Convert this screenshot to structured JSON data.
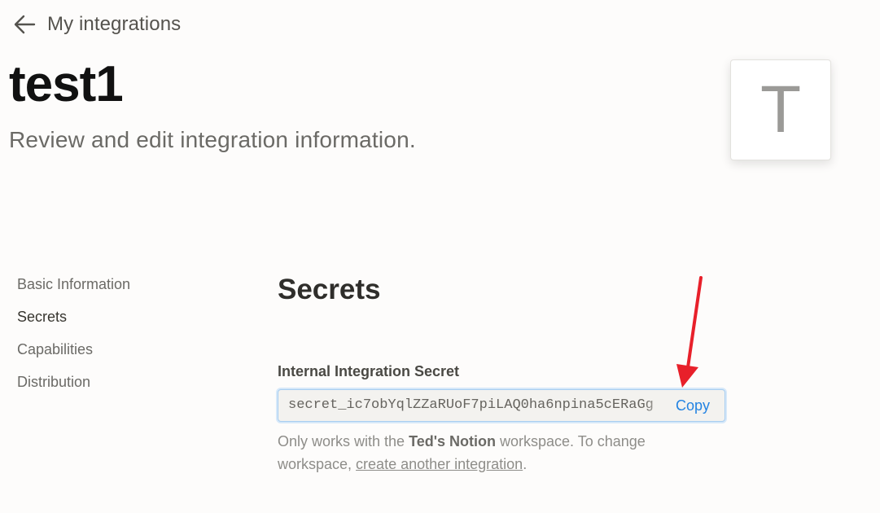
{
  "header": {
    "back_label": "My integrations",
    "title": "test1",
    "subtitle": "Review and edit integration information.",
    "avatar_letter": "T"
  },
  "sidebar": {
    "items": [
      {
        "label": "Basic Information",
        "active": false
      },
      {
        "label": "Secrets",
        "active": true
      },
      {
        "label": "Capabilities",
        "active": false
      },
      {
        "label": "Distribution",
        "active": false
      }
    ]
  },
  "secrets": {
    "title": "Secrets",
    "field_label": "Internal Integration Secret",
    "secret_value": "secret_ic7obYqlZZaRUoF7piLAQ0ha6npina5cERaGg",
    "copy_label": "Copy",
    "help_prefix": "Only works with the ",
    "help_workspace": "Ted's Notion",
    "help_middle": " workspace. To change workspace, ",
    "help_link": "create another integration",
    "help_suffix": "."
  },
  "colors": {
    "accent": "#2383e2",
    "annotation": "#e8202a",
    "background": "#fdfcfb"
  },
  "icons": {
    "back": "arrow-left-icon",
    "annotation": "red-arrow-annotation"
  }
}
